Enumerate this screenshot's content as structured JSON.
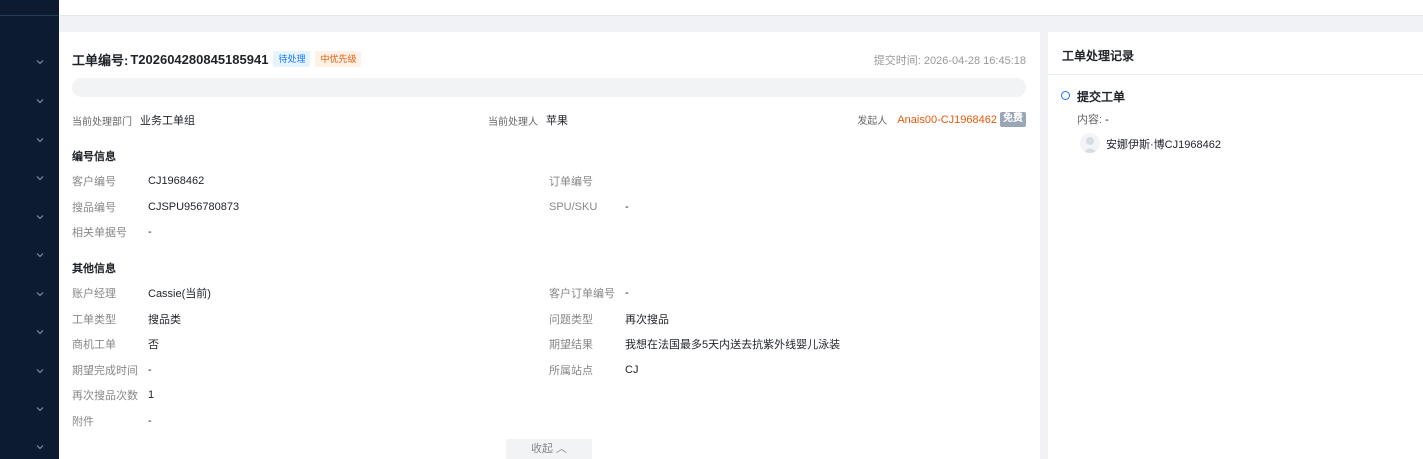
{
  "header": {
    "ticket_label": "工单编号:",
    "ticket_number": "T202604280845185941",
    "status_badge": "待处理",
    "priority_badge": "中优先级",
    "submit_time_label": "提交时间:",
    "submit_time": "2026-04-28 16:45:18"
  },
  "meta": {
    "dept_label": "当前处理部门",
    "dept_value": "业务工单组",
    "handler_label": "当前处理人",
    "handler_value": "苹果",
    "initiator_label": "发起人",
    "initiator_value": "Anais00-CJ1968462",
    "free_tag": "免费"
  },
  "sections": {
    "number_info_title": "编号信息",
    "other_info_title": "其他信息"
  },
  "number_info": {
    "customer_no_label": "客户编号",
    "customer_no_value": "CJ1968462",
    "order_no_label": "订单编号",
    "order_no_value": "",
    "sourcing_no_label": "搜品编号",
    "sourcing_no_value": "CJSPU956780873",
    "spu_sku_label": "SPU/SKU",
    "spu_sku_value": "-",
    "related_doc_label": "相关单据号",
    "related_doc_value": "-"
  },
  "other_info": {
    "account_manager_label": "账户经理",
    "account_manager_value": "Cassie(当前)",
    "customer_order_label": "客户订单编号",
    "customer_order_value": "-",
    "ticket_type_label": "工单类型",
    "ticket_type_value": "搜品类",
    "issue_type_label": "问题类型",
    "issue_type_value": "再次搜品",
    "biz_ticket_label": "商机工单",
    "biz_ticket_value": "否",
    "expected_result_label": "期望结果",
    "expected_result_value": "我想在法国最多5天内送去抗紫外线婴儿泳装",
    "expected_time_label": "期望完成时间",
    "expected_time_value": "-",
    "site_label": "所属站点",
    "site_value": "CJ",
    "resourcing_count_label": "再次搜品次数",
    "resourcing_count_value": "1",
    "attachment_label": "附件",
    "attachment_value": "-"
  },
  "collapse_label": "收起 ︿",
  "records": {
    "title": "工单处理记录",
    "event_title": "提交工单",
    "content_label": "内容:",
    "content_value": "-",
    "user_name": "安娜伊斯·博CJ1968462"
  },
  "colors": {
    "sidebar_bg": "#0c1b30",
    "accent_blue": "#1677ff",
    "accent_orange": "#e8590c"
  }
}
